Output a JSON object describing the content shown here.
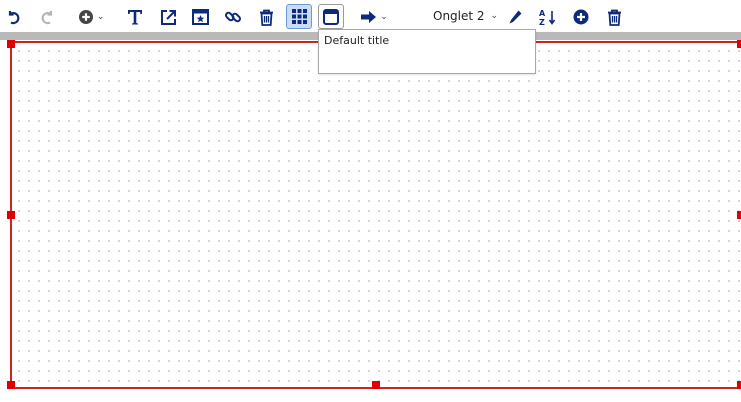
{
  "toolbar": {
    "icons": {
      "undo": "undo-icon",
      "redo": "redo-icon",
      "add": "plus-circle-icon",
      "text": "text-icon",
      "external": "external-link-icon",
      "widget": "star-window-icon",
      "link": "link-icon",
      "delete": "trash-icon",
      "grid": "grid-icon",
      "window": "window-icon",
      "arrow": "arrow-right-icon",
      "edit": "pencil-icon",
      "sort": "sort-az-icon",
      "add_tab": "plus-circle-icon",
      "delete_tab": "trash-icon"
    },
    "tab_select_value": "Onglet 2"
  },
  "tooltip": {
    "text": "Default title"
  },
  "colors": {
    "icon": "#0e2a7a",
    "icon_disabled": "#b5b5b5",
    "pressed_bg": "#c9def5",
    "selection": "#cc2222",
    "handle": "#e00000"
  }
}
